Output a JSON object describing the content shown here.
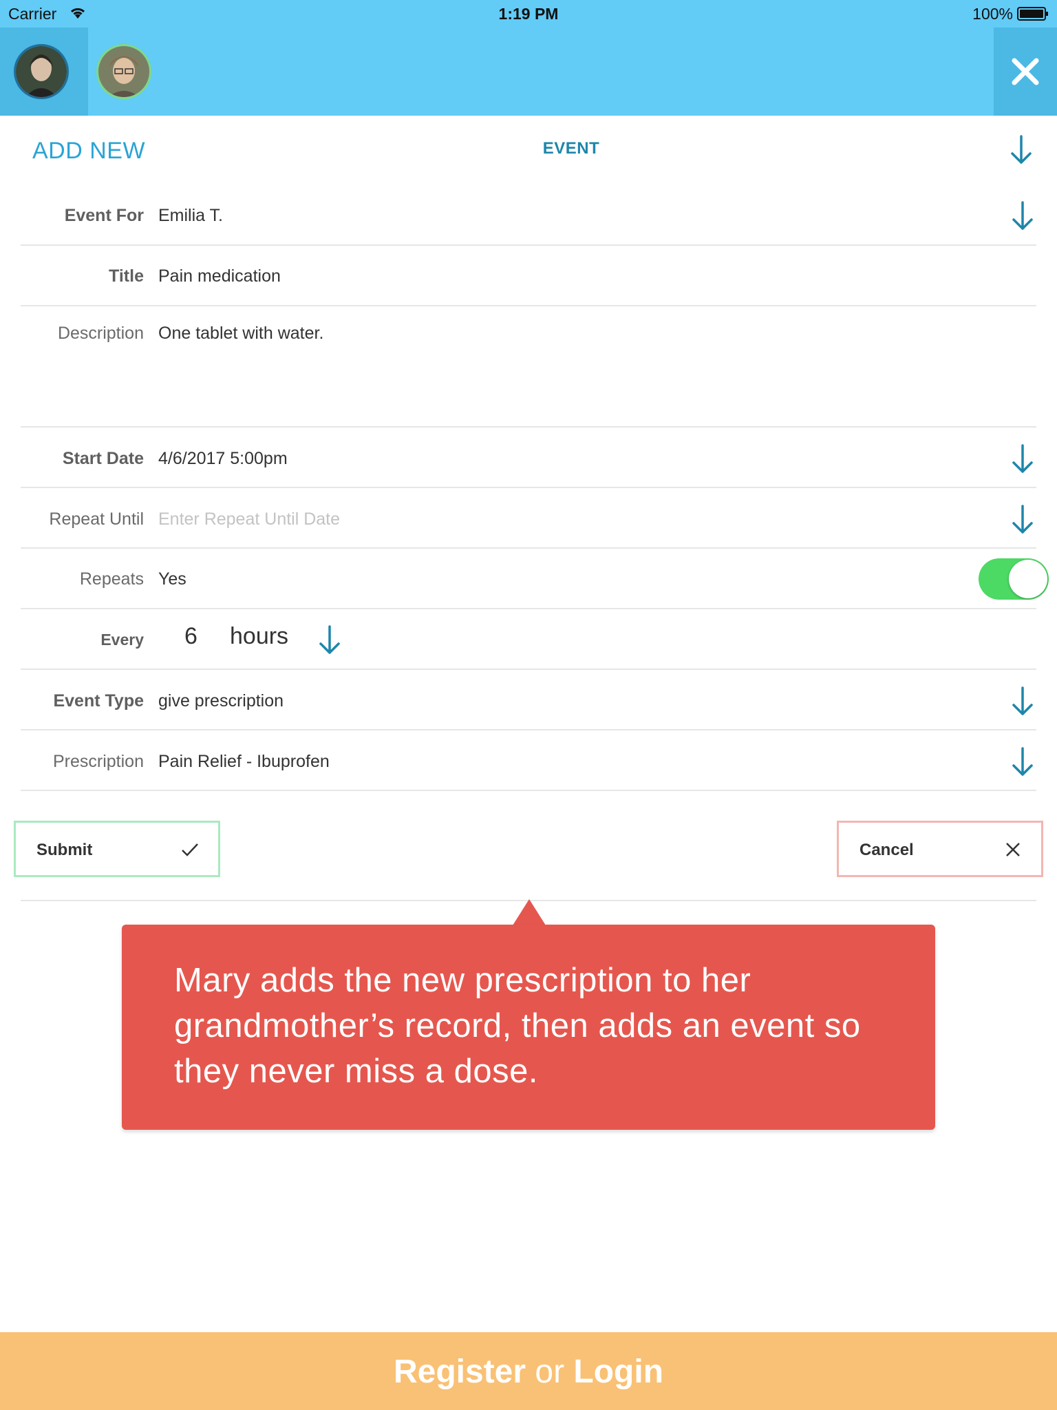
{
  "status_bar": {
    "carrier": "Carrier",
    "time": "1:19 PM",
    "battery": "100%"
  },
  "header": {
    "avatars": [
      {
        "name": "profile-avatar-1",
        "selected": true
      },
      {
        "name": "profile-avatar-2",
        "selected": false
      }
    ]
  },
  "form": {
    "add_new_label": "ADD NEW",
    "heading": "EVENT",
    "fields": {
      "event_for": {
        "label": "Event For",
        "value": "Emilia T."
      },
      "title": {
        "label": "Title",
        "value": "Pain medication"
      },
      "description": {
        "label": "Description",
        "value": "One tablet with water."
      },
      "start_date": {
        "label": "Start Date",
        "value": "4/6/2017 5:00pm"
      },
      "repeat_until": {
        "label": "Repeat Until",
        "placeholder": "Enter Repeat Until Date"
      },
      "repeats": {
        "label": "Repeats",
        "value": "Yes",
        "toggle_on": true
      },
      "every": {
        "label": "Every",
        "number": "6",
        "unit": "hours"
      },
      "event_type": {
        "label": "Event Type",
        "value": "give prescription"
      },
      "prescription": {
        "label": "Prescription",
        "value": "Pain Relief - Ibuprofen"
      }
    },
    "submit_label": "Submit",
    "cancel_label": "Cancel"
  },
  "callout": {
    "text": "Mary adds the new prescription to her grandmother’s record, then adds an event so they never miss a dose."
  },
  "footer": {
    "register": "Register",
    "or": "or",
    "login": "Login"
  },
  "colors": {
    "header": "#62cbf6",
    "accent_blue": "#1e86ab",
    "toggle_green": "#4cd964",
    "callout_red": "#e5574e",
    "footer_orange": "#f9c175",
    "submit_border": "#a9eabf",
    "cancel_border": "#f3b6b2"
  }
}
